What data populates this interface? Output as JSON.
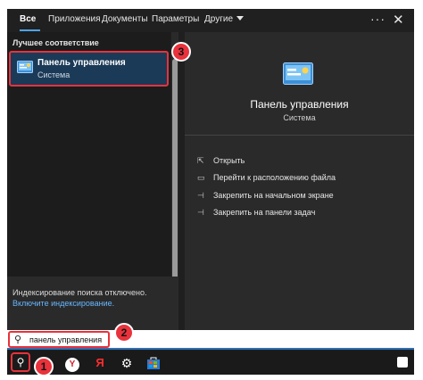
{
  "tabs": [
    {
      "label": "Все",
      "active": true
    },
    {
      "label": "Приложения"
    },
    {
      "label": "Документы"
    },
    {
      "label": "Параметры"
    },
    {
      "label": "Другие"
    }
  ],
  "header_icons": {
    "more": "more-icon",
    "close": "close-icon"
  },
  "left_pane": {
    "section_title": "Лучшее соответствие",
    "best_match": {
      "title": "Панель управления",
      "subtitle": "Система",
      "icon": "control-panel-icon"
    },
    "footer": {
      "notice": "Индексирование поиска отключено.",
      "link": "Включите индексирование."
    }
  },
  "right_pane": {
    "title": "Панель управления",
    "subtitle": "Система",
    "actions": [
      {
        "label": "Открыть",
        "icon": "open-icon"
      },
      {
        "label": "Перейти к расположению файла",
        "icon": "file-location-icon"
      },
      {
        "label": "Закрепить на начальном экране",
        "icon": "pin-icon"
      },
      {
        "label": "Закрепить на панели задач",
        "icon": "pin-icon"
      }
    ]
  },
  "search": {
    "value": "панель управления",
    "icon": "search-icon"
  },
  "taskbar": {
    "items": [
      "search-icon",
      "yandex-browser-icon",
      "yandex-icon",
      "settings-icon",
      "store-icon"
    ],
    "yandex_letter": "Я",
    "yabrowser_letter": "Y"
  },
  "badges": [
    "1",
    "2",
    "3"
  ],
  "colors": {
    "accent": "#4ca3e8",
    "highlight": "#e8323c",
    "selection": "#1b3a57",
    "link": "#67b7ff"
  }
}
